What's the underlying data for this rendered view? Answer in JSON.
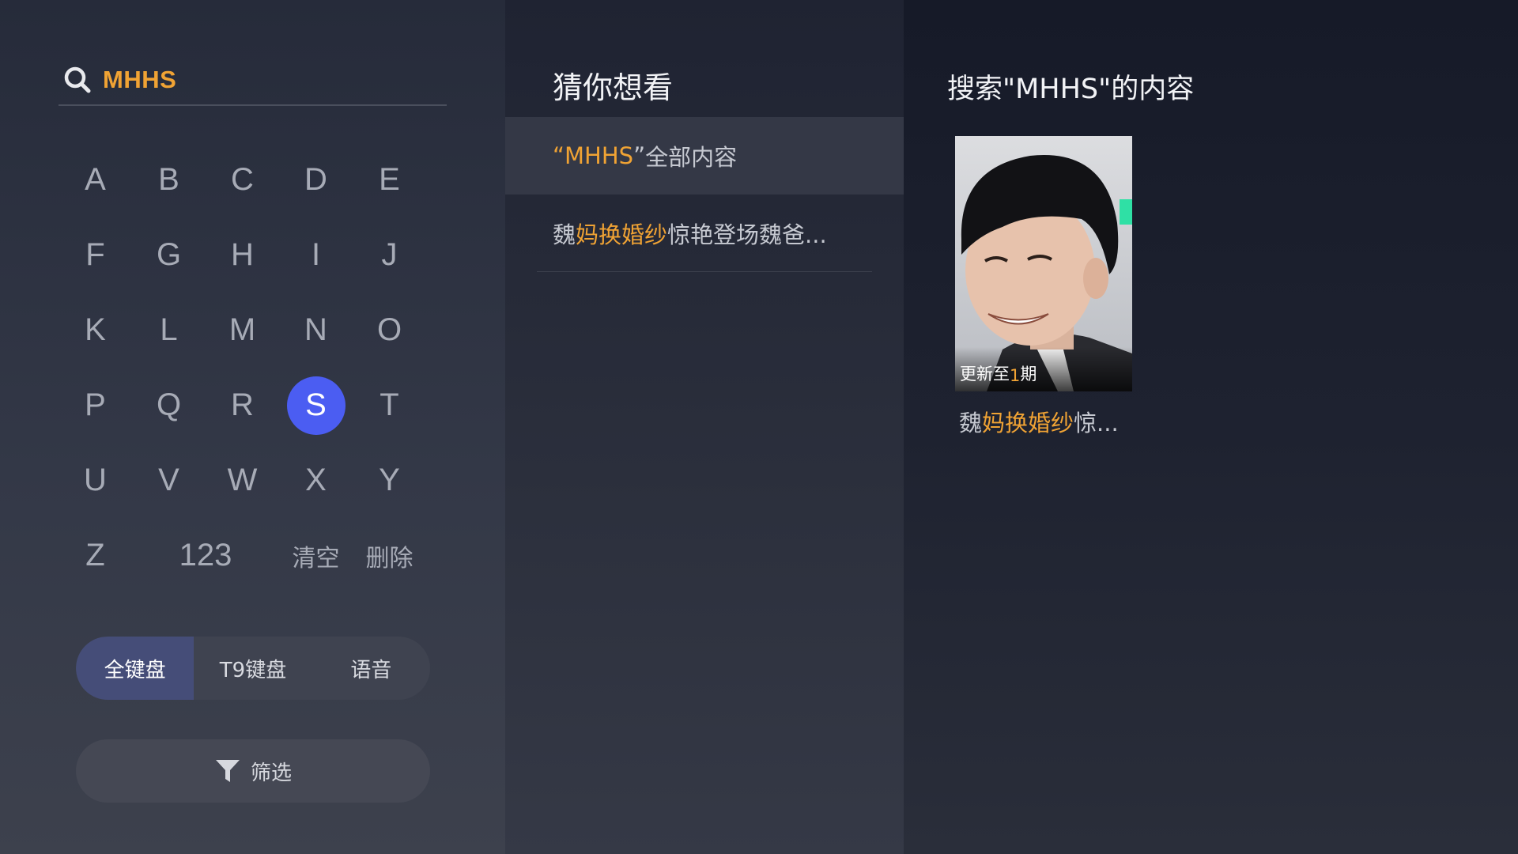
{
  "search": {
    "query": "MHHS",
    "icon": "search-icon"
  },
  "keyboard": {
    "keys": [
      "A",
      "B",
      "C",
      "D",
      "E",
      "F",
      "G",
      "H",
      "I",
      "J",
      "K",
      "L",
      "M",
      "N",
      "O",
      "P",
      "Q",
      "R",
      "S",
      "T",
      "U",
      "V",
      "W",
      "X",
      "Y"
    ],
    "active_key": "S",
    "bottom_row": {
      "z": "Z",
      "num": "123",
      "clear": "清空",
      "delete": "删除"
    },
    "modes": [
      "全键盘",
      "T9键盘",
      "语音"
    ],
    "selected_mode": "全键盘",
    "filter_label": "筛选",
    "filter_icon": "funnel-icon"
  },
  "suggestions": {
    "title": "猜你想看",
    "items": [
      {
        "quote_open": "“",
        "highlight": "MHHS",
        "quote_close": "”",
        "rest": "全部内容"
      },
      {
        "prefix": "魏",
        "highlight": "妈换婚纱",
        "rest": "惊艳登场魏爸..."
      }
    ]
  },
  "results": {
    "title": "搜索\"MHHS\"的内容",
    "cards": [
      {
        "badge_prefix": "更新至",
        "badge_num": "1",
        "badge_suffix": "期",
        "title_prefix": "魏",
        "title_highlight": "妈换婚纱",
        "title_rest": "惊..."
      }
    ]
  },
  "colors": {
    "accent": "#f0a334",
    "key_active": "#4b5df2",
    "mode_selected": "#454d78"
  }
}
